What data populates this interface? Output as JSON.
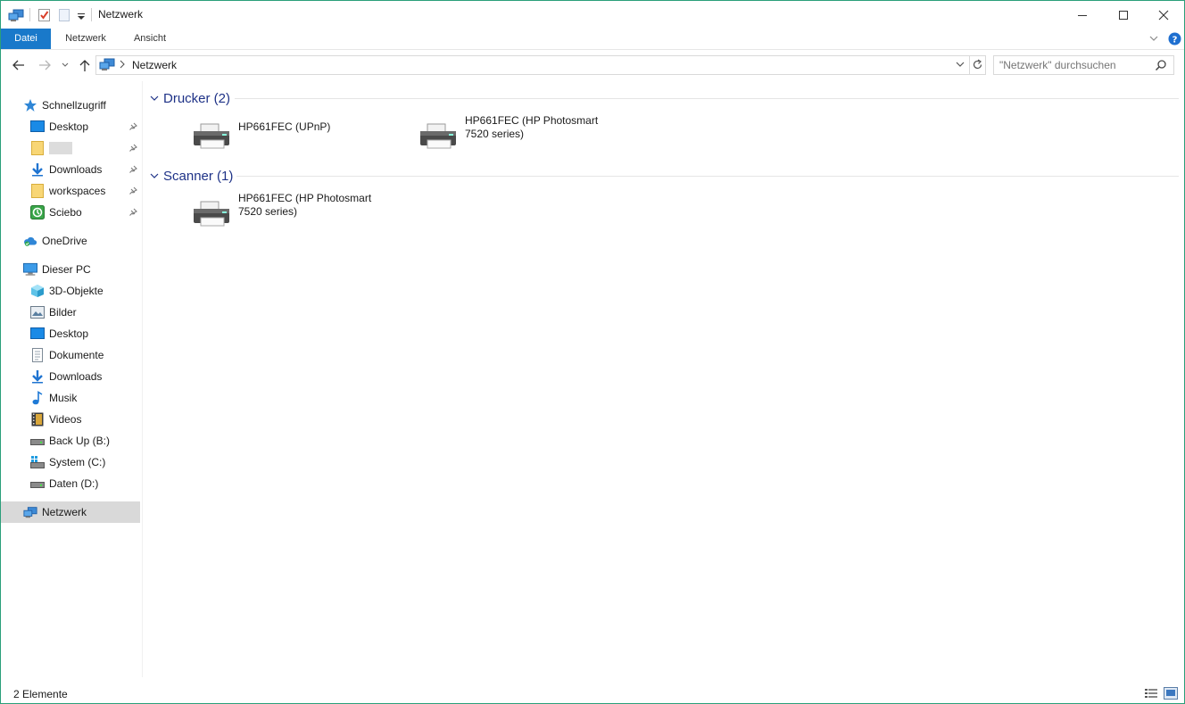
{
  "window": {
    "title": "Netzwerk"
  },
  "ribbon": {
    "tabs": [
      {
        "label": "Datei",
        "active": true
      },
      {
        "label": "Netzwerk",
        "active": false
      },
      {
        "label": "Ansicht",
        "active": false
      }
    ]
  },
  "address": {
    "path": "Netzwerk"
  },
  "search": {
    "placeholder": "\"Netzwerk\" durchsuchen"
  },
  "sidebar": {
    "items": [
      {
        "label": "Schnellzugriff",
        "icon": "star-icon"
      },
      {
        "label": "Desktop",
        "icon": "desktop-icon",
        "pinned": true
      },
      {
        "label": "",
        "icon": "folder-icon",
        "pinned": true
      },
      {
        "label": "Downloads",
        "icon": "download-icon",
        "pinned": true
      },
      {
        "label": "workspaces",
        "icon": "folder-icon",
        "pinned": true
      },
      {
        "label": "Sciebo",
        "icon": "sciebo-icon",
        "pinned": true
      },
      {
        "label": "OneDrive",
        "icon": "onedrive-icon"
      },
      {
        "label": "Dieser PC",
        "icon": "computer-icon"
      },
      {
        "label": "3D-Objekte",
        "icon": "cube-icon"
      },
      {
        "label": "Bilder",
        "icon": "pictures-icon"
      },
      {
        "label": "Desktop",
        "icon": "desktop-icon"
      },
      {
        "label": "Dokumente",
        "icon": "document-icon"
      },
      {
        "label": "Downloads",
        "icon": "download-icon"
      },
      {
        "label": "Musik",
        "icon": "music-icon"
      },
      {
        "label": "Videos",
        "icon": "video-icon"
      },
      {
        "label": "Back Up (B:)",
        "icon": "drive-icon"
      },
      {
        "label": "System (C:)",
        "icon": "system-drive-icon"
      },
      {
        "label": "Daten (D:)",
        "icon": "drive-icon"
      },
      {
        "label": "Netzwerk",
        "icon": "network-icon",
        "selected": true
      }
    ]
  },
  "groups": [
    {
      "title": "Drucker (2)",
      "items": [
        {
          "label": "HP661FEC (UPnP)",
          "icon": "printer-icon"
        },
        {
          "label": "HP661FEC (HP Photosmart\n7520 series)",
          "icon": "printer-icon"
        }
      ]
    },
    {
      "title": "Scanner (1)",
      "items": [
        {
          "label": "HP661FEC (HP Photosmart\n7520 series)",
          "icon": "scanner-icon"
        }
      ]
    }
  ],
  "status": {
    "count": "2 Elemente"
  },
  "colors": {
    "accent": "#1979ca",
    "group_header": "#1e3287",
    "selected_bg": "#d9d9d9",
    "window_border": "#2b9f7a"
  }
}
